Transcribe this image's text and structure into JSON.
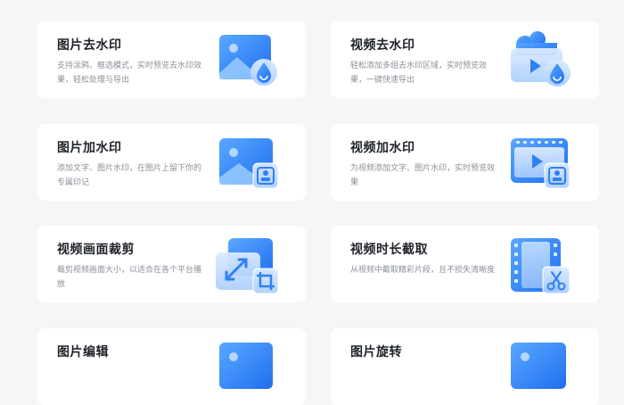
{
  "cards": [
    {
      "title": "图片去水印",
      "desc": "支持涂鸦、框选模式，实时预览去水印效果，轻松处理与导出",
      "icon": "image-remove-watermark-icon"
    },
    {
      "title": "视频去水印",
      "desc": "轻松添加多组去水印区域，实时预览效果，一键快速导出",
      "icon": "video-remove-watermark-icon"
    },
    {
      "title": "图片加水印",
      "desc": "添加文字、图片水印，在图片上留下你的专属印记",
      "icon": "image-add-watermark-icon"
    },
    {
      "title": "视频加水印",
      "desc": "为视频添加文字、图片水印，实时预览效果",
      "icon": "video-add-watermark-icon"
    },
    {
      "title": "视频画面裁剪",
      "desc": "裁剪视频画面大小，以适合在各个平台播放",
      "icon": "video-crop-icon"
    },
    {
      "title": "视频时长截取",
      "desc": "从视频中截取精彩片段，且不损失清晰度",
      "icon": "video-trim-icon"
    },
    {
      "title": "图片编辑",
      "desc": "",
      "icon": "image-edit-icon"
    },
    {
      "title": "图片旋转",
      "desc": "",
      "icon": "image-rotate-icon"
    }
  ],
  "colors": {
    "accent": "#2f80f5",
    "accent_light": "#6fb2ff",
    "background": "#f5f6f8",
    "card": "#ffffff"
  }
}
